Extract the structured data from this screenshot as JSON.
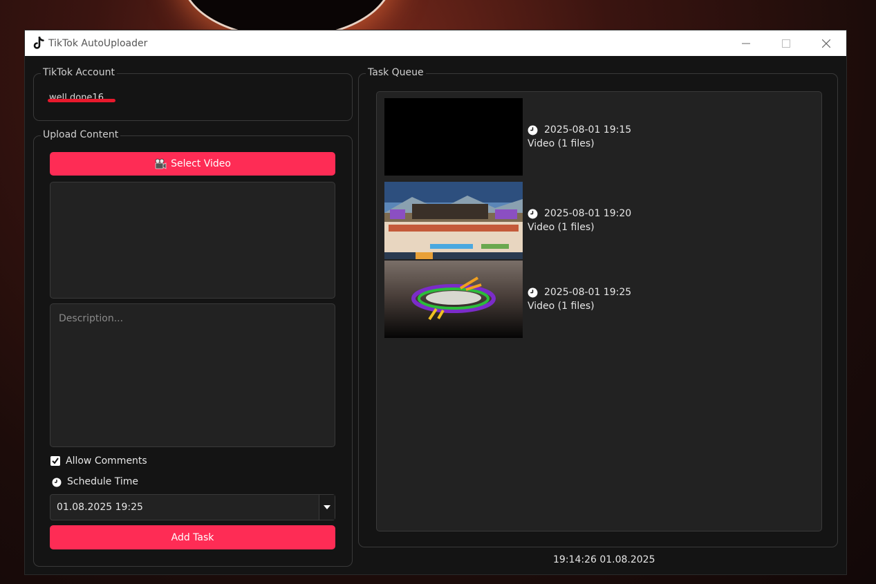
{
  "window": {
    "title": "TikTok AutoUploader",
    "controls": {
      "minimize": "—",
      "maximize": "☐",
      "close": "✕"
    }
  },
  "account": {
    "group_title": "TikTok Account",
    "username": "well.done16"
  },
  "upload": {
    "group_title": "Upload Content",
    "select_video_label": "Select Video",
    "description_placeholder": "Description...",
    "allow_comments_label": "Allow Comments",
    "allow_comments_checked": true,
    "schedule_label": "Schedule Time",
    "schedule_value": "01.08.2025 19:25",
    "add_task_label": "Add Task"
  },
  "queue": {
    "group_title": "Task Queue",
    "tasks": [
      {
        "time": "2025-08-01 19:15",
        "summary": "Video (1 files)",
        "thumbnail": "black-frame"
      },
      {
        "time": "2025-08-01 19:20",
        "summary": "Video (1 files)",
        "thumbnail": "game-screenshot"
      },
      {
        "time": "2025-08-01 19:25",
        "summary": "Video (1 files)",
        "thumbnail": "neon-island"
      }
    ]
  },
  "status": {
    "clock": "19:14:26 01.08.2025"
  },
  "colors": {
    "accent": "#fe2c55",
    "background": "#141414",
    "panel": "#222222"
  }
}
